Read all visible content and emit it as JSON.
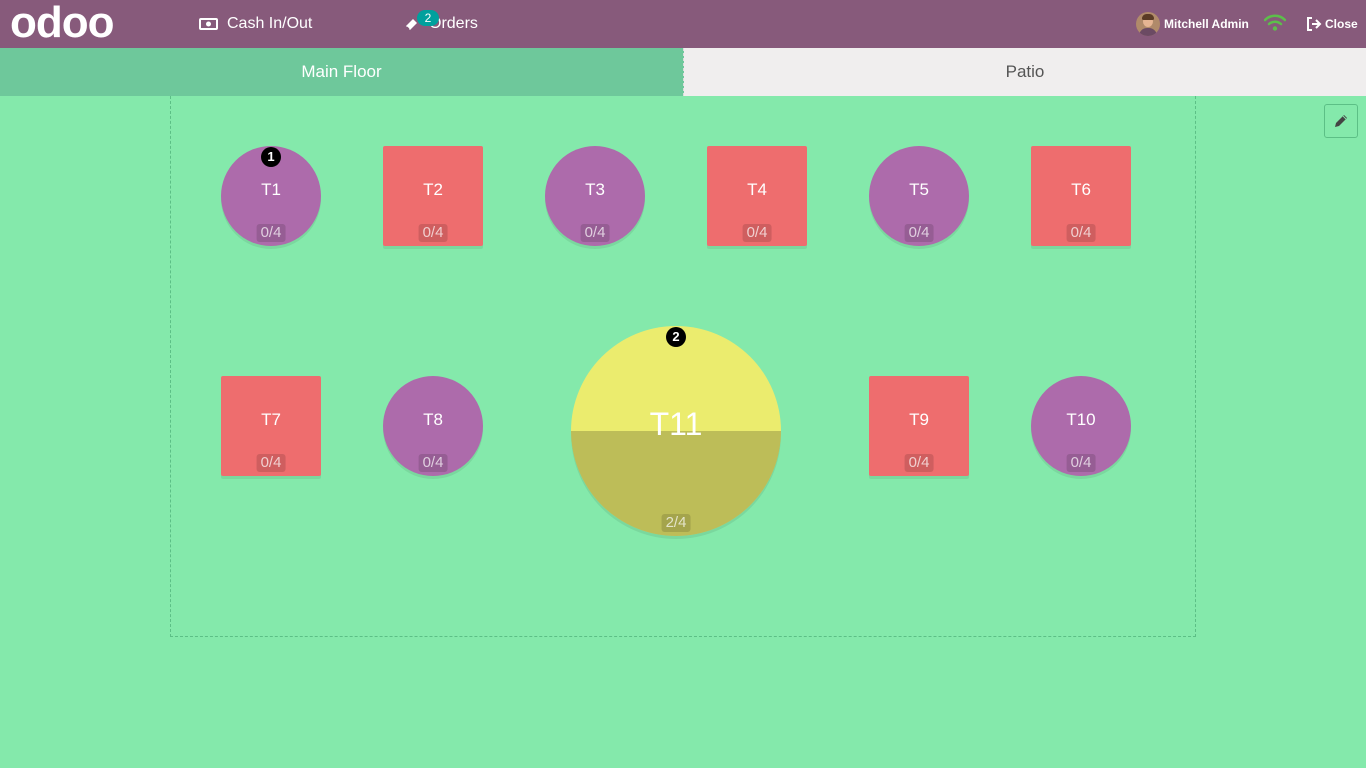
{
  "header": {
    "brand": "odoo",
    "cash_label": "Cash In/Out",
    "orders_label": "Orders",
    "orders_badge": "2",
    "user_name": "Mitchell Admin",
    "close_label": "Close",
    "bar_color": "#875a7b"
  },
  "floors": {
    "tabs": [
      {
        "label": "Main Floor",
        "active": true
      },
      {
        "label": "Patio",
        "active": false
      }
    ]
  },
  "tables": [
    {
      "name": "T1",
      "seats": "0/4",
      "shape": "round",
      "color": "#ad6bab",
      "order_count": "1"
    },
    {
      "name": "T2",
      "seats": "0/4",
      "shape": "square",
      "color": "#ee6d6e"
    },
    {
      "name": "T3",
      "seats": "0/4",
      "shape": "round",
      "color": "#ad6bab"
    },
    {
      "name": "T4",
      "seats": "0/4",
      "shape": "square",
      "color": "#ee6d6e"
    },
    {
      "name": "T5",
      "seats": "0/4",
      "shape": "round",
      "color": "#ad6bab"
    },
    {
      "name": "T6",
      "seats": "0/4",
      "shape": "square",
      "color": "#ee6d6e"
    },
    {
      "name": "T7",
      "seats": "0/4",
      "shape": "square",
      "color": "#ee6d6e"
    },
    {
      "name": "T8",
      "seats": "0/4",
      "shape": "round",
      "color": "#ad6bab"
    },
    {
      "name": "T11",
      "seats": "2/4",
      "shape": "round",
      "color": "#ebec6e",
      "order_count": "2",
      "fill": 0.5
    },
    {
      "name": "T9",
      "seats": "0/4",
      "shape": "square",
      "color": "#ee6d6e"
    },
    {
      "name": "T10",
      "seats": "0/4",
      "shape": "round",
      "color": "#ad6bab"
    }
  ]
}
